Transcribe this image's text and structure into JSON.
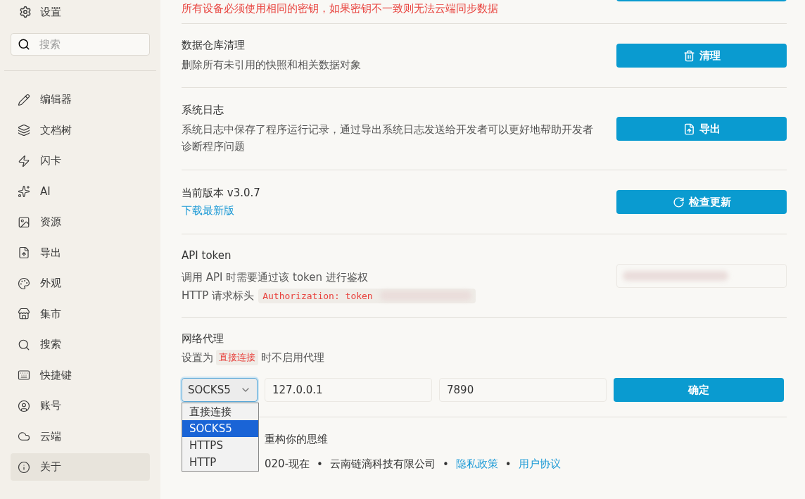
{
  "sidebar": {
    "title": "设置",
    "search": {
      "placeholder": "搜索"
    },
    "items": [
      {
        "label": "编辑器",
        "selected": false
      },
      {
        "label": "文档树",
        "selected": false
      },
      {
        "label": "闪卡",
        "selected": false
      },
      {
        "label": "AI",
        "selected": false
      },
      {
        "label": "资源",
        "selected": false
      },
      {
        "label": "导出",
        "selected": false
      },
      {
        "label": "外观",
        "selected": false
      },
      {
        "label": "集市",
        "selected": false
      },
      {
        "label": "搜索",
        "selected": false
      },
      {
        "label": "快捷键",
        "selected": false
      },
      {
        "label": "账号",
        "selected": false
      },
      {
        "label": "云端",
        "selected": false
      },
      {
        "label": "关于",
        "selected": true
      }
    ]
  },
  "sections": [
    {
      "kind": "cut",
      "warning": "所有设备必须使用相同的密钥，如果密钥不一致则无法云端同步数据"
    },
    {
      "kind": "button",
      "title": "数据仓库清理",
      "description": "删除所有未引用的快照和相关数据对象",
      "button": "清理"
    },
    {
      "kind": "button",
      "title": "系统日志",
      "description": "系统日志中保存了程序运行记录，通过导出系统日志发送给开发者可以更好地帮助开发者诊断程序问题",
      "button": "导出"
    },
    {
      "kind": "version",
      "title": "当前版本 v3.0.7",
      "link": "下载最新版",
      "button": "检查更新"
    },
    {
      "kind": "token",
      "title": "API token",
      "description": "调用 API 时需要通过该 token 进行鉴权",
      "header_label": "HTTP 请求标头",
      "header_code": "Authorization: token"
    },
    {
      "kind": "proxy",
      "title": "网络代理",
      "hint_before": "设置为",
      "hint_code": "直接连接",
      "hint_after": "时不启用代理",
      "scheme": "SOCKS5",
      "host": "127.0.0.1",
      "port": "7890",
      "button": "确定",
      "options": [
        {
          "label": "直接连接",
          "selected": false
        },
        {
          "label": "SOCKS5",
          "selected": true
        },
        {
          "label": "HTTPS",
          "selected": false
        },
        {
          "label": "HTTP",
          "selected": false
        }
      ]
    }
  ],
  "footer": {
    "slogan": "重构你的思维",
    "years": "020-现在",
    "company": "云南链滴科技有限公司",
    "privacy": "隐私政策",
    "terms": "用户协议",
    "separators": [
      "•",
      "•",
      "•"
    ]
  }
}
